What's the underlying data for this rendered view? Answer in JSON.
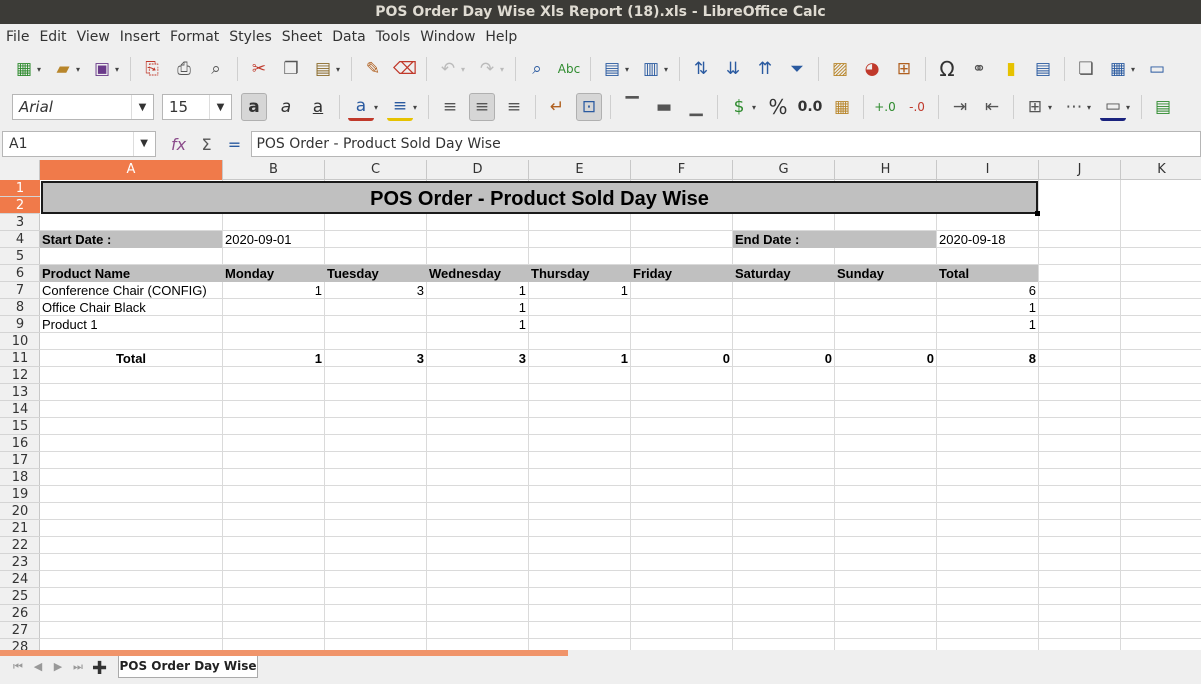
{
  "window": {
    "title": "POS Order Day Wise Xls Report (18).xls - LibreOffice Calc"
  },
  "menu": [
    "File",
    "Edit",
    "View",
    "Insert",
    "Format",
    "Styles",
    "Sheet",
    "Data",
    "Tools",
    "Window",
    "Help"
  ],
  "toolbar": {
    "font_name": "Arial",
    "font_size": "15"
  },
  "formula_bar": {
    "name_box": "A1",
    "fx": "fx",
    "sum": "Σ",
    "eq": "=",
    "content": "POS Order - Product Sold Day Wise"
  },
  "columns": [
    "A",
    "B",
    "C",
    "D",
    "E",
    "F",
    "G",
    "H",
    "I",
    "J",
    "K"
  ],
  "rows": [
    "1",
    "2",
    "3",
    "4",
    "5",
    "6",
    "7",
    "8",
    "9",
    "10",
    "11",
    "12",
    "13",
    "14",
    "15",
    "16",
    "17",
    "18",
    "19",
    "20",
    "21",
    "22",
    "23",
    "24",
    "25",
    "26",
    "27",
    "28"
  ],
  "sheet": {
    "title": "POS Order - Product Sold Day Wise",
    "start_label": "Start Date :",
    "start_value": "2020-09-01",
    "end_label": "End Date :",
    "end_value": "2020-09-18",
    "headers": [
      "Product Name",
      "Monday",
      "Tuesday",
      "Wednesday",
      "Thursday",
      "Friday",
      "Saturday",
      "Sunday",
      "Total"
    ],
    "products": [
      {
        "name": "Conference Chair (CONFIG)",
        "values": [
          "1",
          "3",
          "1",
          "1",
          "",
          "",
          "",
          "6"
        ]
      },
      {
        "name": "Office Chair Black",
        "values": [
          "",
          "",
          "1",
          "",
          "",
          "",
          "",
          "1"
        ]
      },
      {
        "name": "Product 1",
        "values": [
          "",
          "",
          "1",
          "",
          "",
          "",
          "",
          "1"
        ]
      }
    ],
    "total_label": "Total",
    "totals": [
      "1",
      "3",
      "3",
      "1",
      "0",
      "0",
      "0",
      "8"
    ]
  },
  "tabs": {
    "active": "POS Order Day Wise"
  }
}
